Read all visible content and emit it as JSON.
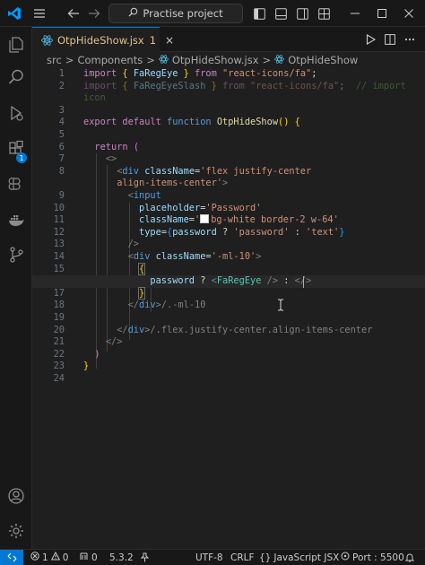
{
  "titlebar": {
    "search_text": "Practise project",
    "icons": [
      "vscode-logo-icon",
      "menu-icon",
      "back-arrow-icon",
      "forward-arrow-icon",
      "search-icon",
      "toggle-primary-sidebar-icon",
      "toggle-panel-icon",
      "toggle-secondary-sidebar-icon",
      "customize-layout-icon"
    ]
  },
  "activitybar": {
    "icons": [
      "explorer-icon",
      "search-icon",
      "run-debug-icon",
      "extensions-icon",
      "source-control-icon",
      "docker-icon",
      "remote-explorer-icon",
      "accounts-icon",
      "manage-gear-icon"
    ],
    "extensions_badge": "1"
  },
  "tab": {
    "filename": "OtpHideShow.jsx",
    "problems": "1",
    "close": "×"
  },
  "breadcrumb": {
    "parts": [
      "src",
      ">",
      "Components",
      ">",
      "OtpHideShow.jsx",
      ">",
      "OtpHideShow"
    ]
  },
  "editor": {
    "active_line": 16,
    "line_numbers": [
      "1",
      "2",
      "3",
      "4",
      "5",
      "6",
      "7",
      "8",
      "9",
      "10",
      "11",
      "12",
      "13",
      "14",
      "15",
      "16",
      "17",
      "18",
      "19",
      "20",
      "21",
      "22",
      "23",
      "24"
    ]
  },
  "status": {
    "errors": "1",
    "warnings": "0",
    "ports_count": "0",
    "version": "5.3.2",
    "encoding": "UTF-8",
    "eol": "CRLF",
    "braces": "{}",
    "language": "JavaScript JSX",
    "port": "Port : 5500"
  }
}
